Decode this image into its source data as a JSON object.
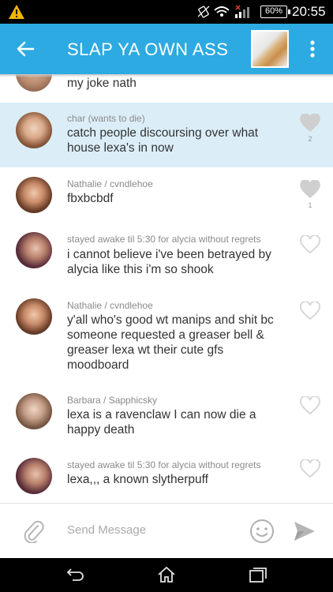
{
  "status_bar": {
    "battery": "60%",
    "time": "20:55"
  },
  "app_bar": {
    "title": "SLAP YA OWN ASS"
  },
  "messages": [
    {
      "sender": "",
      "text": "my joke nath",
      "likes": "",
      "liked": false,
      "highlight": false
    },
    {
      "sender": "char (wants to die)",
      "text": "catch people discoursing over what house lexa's in now",
      "likes": "2",
      "liked": true,
      "highlight": true
    },
    {
      "sender": "Nathalie / cvndlehoe",
      "text": "fbxbcbdf",
      "likes": "1",
      "liked": true,
      "highlight": false
    },
    {
      "sender": "stayed awake til 5:30 for alycia without regrets",
      "text": "i cannot believe i've been betrayed by alycia like this i'm so shook",
      "likes": "",
      "liked": false,
      "highlight": false
    },
    {
      "sender": "Nathalie / cvndlehoe",
      "text": "y'all who's good wt manips and shit bc someone requested a greaser bell & greaser lexa wt their cute gfs moodboard",
      "likes": "",
      "liked": false,
      "highlight": false
    },
    {
      "sender": "Barbara / Sapphicsky",
      "text": "lexa is a ravenclaw I can now die a happy death",
      "likes": "",
      "liked": false,
      "highlight": false
    },
    {
      "sender": "stayed awake til 5:30 for alycia without regrets",
      "text": "lexa,,, a known slytherpuff",
      "likes": "",
      "liked": false,
      "highlight": false
    }
  ],
  "composer": {
    "placeholder": "Send Message"
  },
  "colors": {
    "accent": "#2daae1",
    "highlight_row": "#dbeef8",
    "liked_heart": "#cfcfcf",
    "outline_heart": "#d4d4d4"
  },
  "icons": {
    "status_warning": "warning-icon",
    "back": "arrow-left-icon",
    "more": "more-vertical-icon",
    "like": "heart-icon",
    "attach": "paperclip-icon",
    "emoji": "smiley-icon",
    "send": "send-icon",
    "nav_back": "nav-back-icon",
    "nav_home": "nav-home-icon",
    "nav_recents": "nav-recents-icon"
  }
}
